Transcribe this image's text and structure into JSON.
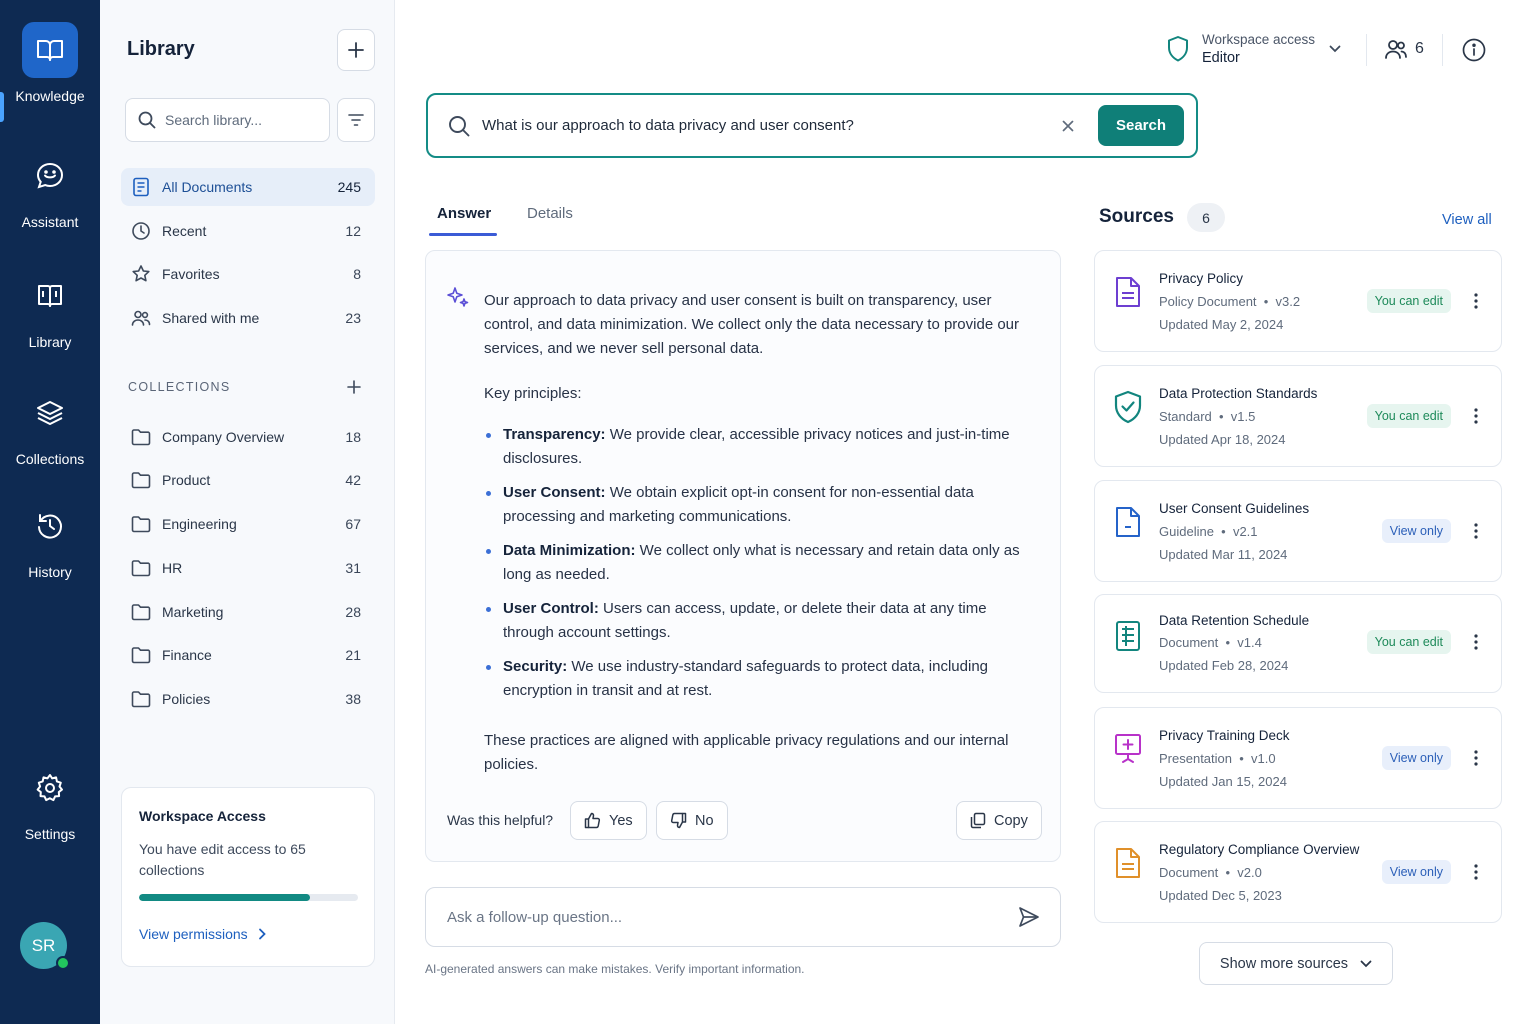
{
  "rail": {
    "items": [
      {
        "label": "Knowledge",
        "icon": "book-open-icon"
      },
      {
        "label": "Assistant",
        "icon": "chat-bot-icon"
      },
      {
        "label": "Library",
        "icon": "library-icon"
      },
      {
        "label": "Collections",
        "icon": "layers-icon"
      },
      {
        "label": "History",
        "icon": "history-icon"
      },
      {
        "label": "Settings",
        "icon": "gear-icon"
      }
    ],
    "active": "Knowledge",
    "avatar_initials": "SR",
    "presence_color": "#22c55e"
  },
  "library": {
    "title": "Library",
    "search_placeholder": "Search library...",
    "nav": [
      {
        "label": "All Documents",
        "count": "245"
      },
      {
        "label": "Recent",
        "count": "12"
      },
      {
        "label": "Favorites",
        "count": "8"
      },
      {
        "label": "Shared with me",
        "count": "23"
      }
    ],
    "collections_heading": "COLLECTIONS",
    "collections": [
      {
        "label": "Company Overview",
        "count": "18"
      },
      {
        "label": "Product",
        "count": "42"
      },
      {
        "label": "Engineering",
        "count": "67"
      },
      {
        "label": "HR",
        "count": "31"
      },
      {
        "label": "Marketing",
        "count": "28"
      },
      {
        "label": "Finance",
        "count": "21"
      },
      {
        "label": "Policies",
        "count": "38"
      }
    ],
    "workspace_card": {
      "title": "Workspace Access",
      "description": "You have edit access to 65 collections",
      "progress": 0.78,
      "link": "View permissions"
    }
  },
  "header": {
    "access_label": "Workspace access",
    "access_role": "Editor",
    "member_count": "6"
  },
  "search": {
    "query": "What is our approach to data privacy and user consent?",
    "button": "Search"
  },
  "tabs": [
    {
      "label": "Answer"
    },
    {
      "label": "Details"
    }
  ],
  "answer": {
    "intro": "Our approach to data privacy and user consent is built on transparency, user control, and data minimization. We collect only the data necessary to provide our services, and we never sell personal data.",
    "key_heading": "Key principles:",
    "principles": [
      {
        "term": "Transparency:",
        "text": " We provide clear, accessible privacy notices and just-in-time disclosures."
      },
      {
        "term": "User Consent:",
        "text": " We obtain explicit opt-in consent for non-essential data processing and marketing communications."
      },
      {
        "term": "Data Minimization:",
        "text": " We collect only what is necessary and retain data only as long as needed."
      },
      {
        "term": "User Control:",
        "text": " Users can access, update, or delete their data at any time through account settings."
      },
      {
        "term": "Security:",
        "text": " We use industry-standard safeguards to protect data, including encryption in transit and at rest."
      }
    ],
    "outro": "These practices are aligned with applicable privacy regulations and our internal policies.",
    "helpful_label": "Was this helpful?",
    "yes": "Yes",
    "no": "No",
    "copy": "Copy"
  },
  "followup": {
    "placeholder": "Ask a follow-up question..."
  },
  "disclaimer": "AI-generated answers can make mistakes. Verify important information.",
  "sources": {
    "title": "Sources",
    "count": "6",
    "view_all": "View all",
    "items": [
      {
        "name": "Privacy Policy",
        "type": "Policy Document",
        "version": "v3.2",
        "updated": "Updated May 2, 2024",
        "access": "You can edit",
        "icon": "document-icon",
        "color": "#6d3fd1"
      },
      {
        "name": "Data Protection Standards",
        "type": "Standard",
        "version": "v1.5",
        "updated": "Updated Apr 18, 2024",
        "access": "You can edit",
        "icon": "shield-check-icon",
        "color": "#12857e"
      },
      {
        "name": "User Consent Guidelines",
        "type": "Guideline",
        "version": "v2.1",
        "updated": "Updated Mar 11, 2024",
        "access": "View only",
        "icon": "file-icon",
        "color": "#2563c9"
      },
      {
        "name": "Data Retention Schedule",
        "type": "Document",
        "version": "v1.4",
        "updated": "Updated Feb 28, 2024",
        "access": "You can edit",
        "icon": "spreadsheet-icon",
        "color": "#12857e"
      },
      {
        "name": "Privacy Training Deck",
        "type": "Presentation",
        "version": "v1.0",
        "updated": "Updated Jan 15, 2024",
        "access": "View only",
        "icon": "presentation-icon",
        "color": "#b832c9"
      },
      {
        "name": "Regulatory Compliance Overview",
        "type": "Document",
        "version": "v2.0",
        "updated": "Updated Dec 5, 2023",
        "access": "View only",
        "icon": "document-icon",
        "color": "#e0902a"
      }
    ],
    "show_more": "Show more sources"
  },
  "colors": {
    "rail_bg": "#0e2a52",
    "accent_teal": "#0f7f78",
    "link_blue": "#1d5fbf"
  }
}
